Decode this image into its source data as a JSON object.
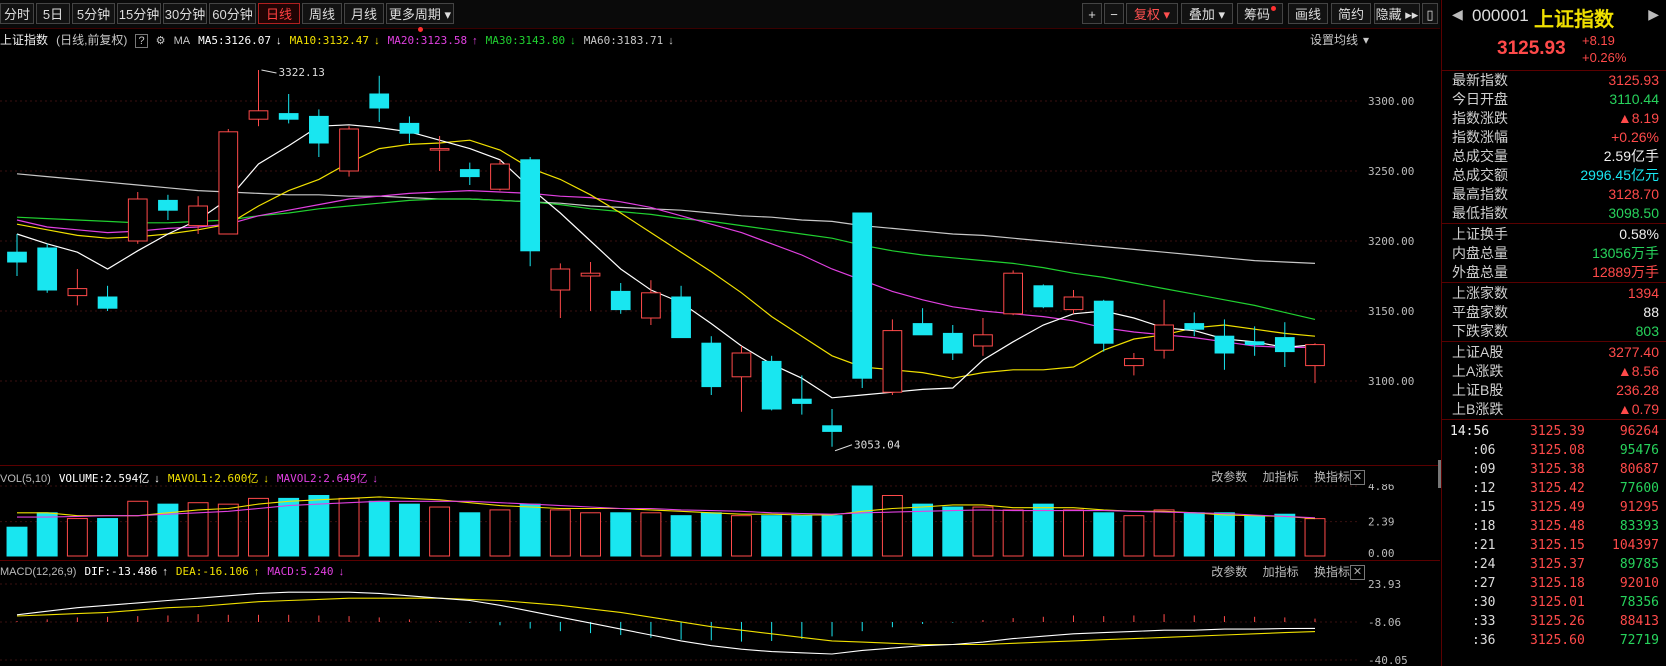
{
  "toolbar": {
    "periods": [
      "分时",
      "5日",
      "5分钟",
      "15分钟",
      "30分钟",
      "60分钟",
      "日线",
      "周线",
      "月线",
      "更多周期"
    ],
    "active_period": "日线",
    "right_buttons": [
      "+",
      "−",
      "复权",
      "叠加",
      "筹码",
      "画线",
      "简约",
      "隐藏"
    ]
  },
  "main_legend": {
    "name": "上证指数",
    "mode": "(日线,前复权)",
    "ma_label": "MA",
    "ma5": "MA5:3126.07",
    "ma10": "MA10:3132.47",
    "ma20": "MA20:3123.58",
    "ma30": "MA30:3143.80",
    "ma60": "MA60:3183.71",
    "settings": "设置均线"
  },
  "price_axis": [
    "3300.00",
    "3250.00",
    "3200.00",
    "3150.00",
    "3100.00"
  ],
  "high_label": "3322.13",
  "low_label": "3053.04",
  "vol_legend": {
    "name": "VOL(5,10)",
    "volume": "VOLUME:2.594亿",
    "mavol1": "MAVOL1:2.600亿",
    "mavol2": "MAVOL2:2.649亿"
  },
  "vol_axis": [
    "4.86",
    "2.39",
    "0.00"
  ],
  "macd_legend": {
    "name": "MACD(12,26,9)",
    "dif": "DIF:-13.486",
    "dea": "DEA:-16.106",
    "macd": "MACD:5.240"
  },
  "macd_axis": [
    "23.93",
    "-8.06",
    "-40.05"
  ],
  "panel_tools": [
    "改参数",
    "加指标",
    "换指标"
  ],
  "sidebar": {
    "code": "000001",
    "name": "上证指数",
    "price": "3125.93",
    "change": "+8.19",
    "change_pct": "+0.26%",
    "stats": [
      {
        "k": "最新指数",
        "v": "3125.93",
        "c": "up"
      },
      {
        "k": "今日开盘",
        "v": "3110.44",
        "c": "down"
      },
      {
        "k": "指数涨跌",
        "v": "▲8.19",
        "c": "up"
      },
      {
        "k": "指数涨幅",
        "v": "+0.26%",
        "c": "up"
      },
      {
        "k": "总成交量",
        "v": "2.59亿手",
        "c": "white"
      },
      {
        "k": "总成交额",
        "v": "2996.45亿元",
        "c": "cyan"
      },
      {
        "k": "最高指数",
        "v": "3128.70",
        "c": "up"
      },
      {
        "k": "最低指数",
        "v": "3098.50",
        "c": "down"
      }
    ],
    "stats2": [
      {
        "k": "上证换手",
        "v": "0.58%",
        "c": "white"
      },
      {
        "k": "内盘总量",
        "v": "13056万手",
        "c": "down"
      },
      {
        "k": "外盘总量",
        "v": "12889万手",
        "c": "up"
      }
    ],
    "stats3": [
      {
        "k": "上涨家数",
        "v": "1394",
        "c": "up"
      },
      {
        "k": "平盘家数",
        "v": "88",
        "c": "white"
      },
      {
        "k": "下跌家数",
        "v": "803",
        "c": "down"
      }
    ],
    "stats4": [
      {
        "k": "上证A股",
        "v": "3277.40",
        "c": "up"
      },
      {
        "k": "上A涨跌",
        "v": "▲8.56",
        "c": "up"
      },
      {
        "k": "上证B股",
        "v": "236.28",
        "c": "up"
      },
      {
        "k": "上B涨跌",
        "v": "▲0.79",
        "c": "up"
      }
    ],
    "ticks": [
      {
        "t": "14:56",
        "p": "3125.39",
        "q": "96264"
      },
      {
        "t": ":06",
        "p": "3125.08",
        "q": "95476"
      },
      {
        "t": ":09",
        "p": "3125.38",
        "q": "80687"
      },
      {
        "t": ":12",
        "p": "3125.42",
        "q": "77600"
      },
      {
        "t": ":15",
        "p": "3125.49",
        "q": "91295"
      },
      {
        "t": ":18",
        "p": "3125.48",
        "q": "83393"
      },
      {
        "t": ":21",
        "p": "3125.15",
        "q": "104397"
      },
      {
        "t": ":24",
        "p": "3125.37",
        "q": "89785"
      },
      {
        "t": ":27",
        "p": "3125.18",
        "q": "92010"
      },
      {
        "t": ":30",
        "p": "3125.01",
        "q": "78356"
      },
      {
        "t": ":33",
        "p": "3125.26",
        "q": "88413"
      },
      {
        "t": ":36",
        "p": "3125.60",
        "q": "72719"
      }
    ]
  },
  "chart_data": {
    "type": "candlestick",
    "ylim": [
      3040,
      3340
    ],
    "candles": [
      [
        3192,
        3205,
        3175,
        3185
      ],
      [
        3195,
        3198,
        3163,
        3165
      ],
      [
        3161,
        3180,
        3154,
        3166
      ],
      [
        3160,
        3168,
        3150,
        3152
      ],
      [
        3200,
        3235,
        3198,
        3230
      ],
      [
        3229,
        3233,
        3215,
        3222
      ],
      [
        3211,
        3232,
        3205,
        3225
      ],
      [
        3205,
        3280,
        3205,
        3278
      ],
      [
        3287,
        3322.13,
        3282,
        3293
      ],
      [
        3291,
        3305,
        3284,
        3287
      ],
      [
        3289,
        3294,
        3260,
        3270
      ],
      [
        3250,
        3282,
        3246,
        3280
      ],
      [
        3305,
        3318,
        3285,
        3295
      ],
      [
        3284,
        3289,
        3270,
        3277
      ],
      [
        3266,
        3275,
        3250,
        3266
      ],
      [
        3251,
        3256,
        3240,
        3246
      ],
      [
        3237,
        3258,
        3236,
        3255
      ],
      [
        3258,
        3260,
        3182,
        3193
      ],
      [
        3165,
        3184,
        3145,
        3180
      ],
      [
        3175,
        3185,
        3150,
        3177
      ],
      [
        3164,
        3170,
        3148,
        3151
      ],
      [
        3145,
        3172,
        3140,
        3163
      ],
      [
        3160,
        3168,
        3133,
        3131
      ],
      [
        3127,
        3132,
        3090,
        3096
      ],
      [
        3103,
        3125,
        3078,
        3120
      ],
      [
        3114,
        3118,
        3079,
        3080
      ],
      [
        3087,
        3104,
        3076,
        3084
      ],
      [
        3068,
        3080,
        3053.04,
        3064
      ],
      [
        3220,
        3220,
        3095,
        3102
      ],
      [
        3092,
        3144,
        3090,
        3136
      ],
      [
        3141,
        3152,
        3134,
        3133
      ],
      [
        3134,
        3140,
        3115,
        3120
      ],
      [
        3125,
        3145,
        3118,
        3133
      ],
      [
        3148,
        3179,
        3147,
        3177
      ],
      [
        3168,
        3169,
        3152,
        3153
      ],
      [
        3151,
        3165,
        3148,
        3160
      ],
      [
        3157,
        3158,
        3121,
        3127
      ],
      [
        3111,
        3120,
        3104,
        3116
      ],
      [
        3122,
        3158,
        3116,
        3140
      ],
      [
        3141,
        3149,
        3132,
        3137
      ],
      [
        3132,
        3144,
        3108,
        3120
      ],
      [
        3128,
        3139,
        3118,
        3126
      ],
      [
        3131,
        3142,
        3110,
        3121
      ],
      [
        3111,
        3127,
        3098.5,
        3126
      ]
    ],
    "ma5": [
      3205,
      3198,
      3192,
      3180,
      3193,
      3205,
      3215,
      3230,
      3255,
      3268,
      3282,
      3283,
      3281,
      3278,
      3272,
      3266,
      3258,
      3238,
      3220,
      3200,
      3180,
      3165,
      3156,
      3141,
      3125,
      3112,
      3102,
      3088,
      3090,
      3092,
      3094,
      3095,
      3115,
      3128,
      3140,
      3148,
      3150,
      3145,
      3138,
      3136,
      3130,
      3128,
      3124,
      3126
    ],
    "ma10": [
      3212,
      3208,
      3204,
      3202,
      3203,
      3205,
      3208,
      3212,
      3225,
      3236,
      3244,
      3256,
      3266,
      3269,
      3270,
      3272,
      3265,
      3252,
      3244,
      3233,
      3220,
      3206,
      3192,
      3178,
      3163,
      3146,
      3132,
      3118,
      3110,
      3108,
      3106,
      3102,
      3106,
      3108,
      3108,
      3110,
      3122,
      3130,
      3133,
      3138,
      3140,
      3137,
      3134,
      3132
    ],
    "ma20": [
      3215,
      3210,
      3208,
      3206,
      3207,
      3209,
      3210,
      3212,
      3218,
      3222,
      3226,
      3230,
      3232,
      3234,
      3235,
      3236,
      3235,
      3234,
      3232,
      3231,
      3228,
      3224,
      3218,
      3212,
      3206,
      3198,
      3190,
      3180,
      3172,
      3164,
      3158,
      3153,
      3150,
      3148,
      3146,
      3143,
      3138,
      3135,
      3133,
      3131,
      3128,
      3125,
      3124,
      3124
    ],
    "ma30": [
      3217,
      3216,
      3215,
      3214,
      3213,
      3213,
      3214,
      3215,
      3218,
      3220,
      3223,
      3225,
      3227,
      3229,
      3230,
      3230,
      3229,
      3228,
      3226,
      3223,
      3221,
      3219,
      3216,
      3214,
      3211,
      3208,
      3205,
      3202,
      3197,
      3193,
      3190,
      3188,
      3186,
      3184,
      3181,
      3177,
      3174,
      3170,
      3166,
      3162,
      3158,
      3154,
      3149,
      3144
    ],
    "ma60": [
      3248,
      3246,
      3244,
      3242,
      3240,
      3238,
      3236,
      3235,
      3234,
      3233,
      3233,
      3232,
      3232,
      3231,
      3230,
      3230,
      3229,
      3228,
      3227,
      3225,
      3224,
      3223,
      3222,
      3220,
      3218,
      3217,
      3215,
      3214,
      3211,
      3209,
      3207,
      3205,
      3204,
      3202,
      3200,
      3198,
      3196,
      3194,
      3192,
      3190,
      3188,
      3186,
      3185,
      3184
    ],
    "volume": [
      2.0,
      3.0,
      2.6,
      2.6,
      3.8,
      3.6,
      3.7,
      3.6,
      4.0,
      4.0,
      4.2,
      4.0,
      3.8,
      3.6,
      3.4,
      3.0,
      3.2,
      3.6,
      3.2,
      3.0,
      3.0,
      3.0,
      2.8,
      3.0,
      2.8,
      2.8,
      2.8,
      2.8,
      4.86,
      4.2,
      3.6,
      3.4,
      3.4,
      3.2,
      3.6,
      3.2,
      3.0,
      2.8,
      3.2,
      3.0,
      3.0,
      2.8,
      2.9,
      2.594
    ],
    "mavol1": [
      3.0,
      3.0,
      2.8,
      2.8,
      2.8,
      3.0,
      3.2,
      3.3,
      3.6,
      3.8,
      3.9,
      4.0,
      4.1,
      4.0,
      3.9,
      3.7,
      3.5,
      3.4,
      3.3,
      3.3,
      3.3,
      3.2,
      3.1,
      3.0,
      2.9,
      2.9,
      2.85,
      2.85,
      3.1,
      3.3,
      3.4,
      3.55,
      3.55,
      3.35,
      3.35,
      3.35,
      3.2,
      3.1,
      3.1,
      3.0,
      2.85,
      2.8,
      2.75,
      2.6
    ],
    "mavol2": [
      2.7,
      2.7,
      2.75,
      2.8,
      2.8,
      2.9,
      3.0,
      3.1,
      3.3,
      3.5,
      3.6,
      3.7,
      3.8,
      3.8,
      3.8,
      3.8,
      3.7,
      3.6,
      3.5,
      3.4,
      3.3,
      3.3,
      3.2,
      3.15,
      3.1,
      3.0,
      2.95,
      2.9,
      3.0,
      3.05,
      3.1,
      3.15,
      3.2,
      3.15,
      3.15,
      3.15,
      3.15,
      3.1,
      3.05,
      3.0,
      2.95,
      2.85,
      2.75,
      2.649
    ],
    "dif": [
      -2,
      1,
      4,
      6,
      8,
      10,
      12,
      14,
      16,
      17,
      17,
      17,
      16,
      14,
      12,
      10,
      6,
      1,
      -4,
      -9,
      -14,
      -19,
      -24,
      -28,
      -31,
      -33,
      -34,
      -35,
      -32,
      -30,
      -28,
      -27,
      -25,
      -22,
      -20,
      -18,
      -17,
      -16,
      -15,
      -15,
      -14,
      -14,
      -13.5,
      -13.486
    ],
    "dea": [
      -3,
      -2,
      -1,
      0,
      2,
      4,
      5,
      7,
      9,
      10,
      11,
      12,
      12,
      12,
      12,
      11,
      10,
      8,
      6,
      3,
      0,
      -4,
      -8,
      -12,
      -15,
      -18,
      -21,
      -24,
      -25,
      -26,
      -27,
      -27,
      -27,
      -26,
      -25,
      -24,
      -23,
      -22,
      -21,
      -20,
      -19,
      -18,
      -17,
      -16.106
    ],
    "macd": [
      1.5,
      4,
      7,
      8,
      9,
      10,
      12,
      11,
      11,
      11,
      10,
      9,
      7,
      4,
      1,
      -1,
      -5,
      -10,
      -14,
      -17,
      -20,
      -24,
      -27,
      -28,
      -30,
      -29,
      -26,
      -22,
      -14,
      -8,
      -3,
      -1,
      3,
      6,
      8,
      10,
      9,
      10,
      12,
      10,
      9,
      8,
      7,
      5.24
    ],
    "macd_ylim": [
      -40.05,
      23.93
    ],
    "vol_ylim": [
      0,
      4.86
    ]
  }
}
